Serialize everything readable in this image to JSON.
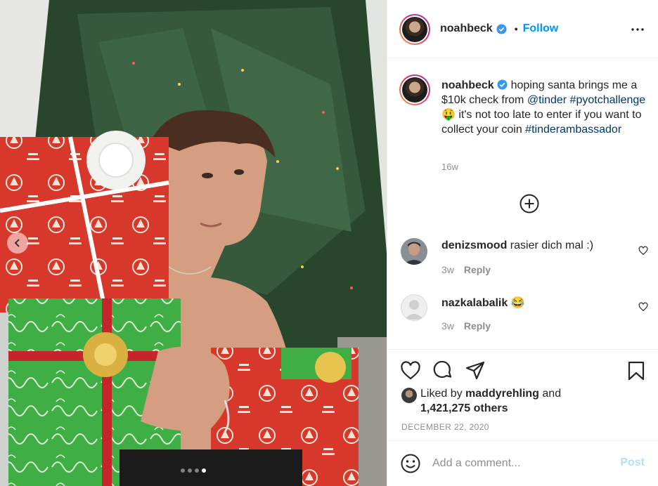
{
  "post": {
    "carousel": {
      "total_slides": 4,
      "active_slide": 4,
      "prev_icon": "chevron-left-icon"
    },
    "header": {
      "username": "noahbeck",
      "separator": "•",
      "follow_label": "Follow",
      "more_icon": "more-horizontal-icon",
      "verified_icon": "verified-badge-icon"
    },
    "caption": {
      "username": "noahbeck",
      "text_1": "hoping santa brings me a $10k check from ",
      "mention": "@tinder",
      "hashtag_1": "#pyotchallenge",
      "emoji": "🤑",
      "text_2": " it's not too late to enter if you want to collect your coin ",
      "hashtag_2": "#tinderambassador",
      "time_ago": "16w",
      "load_more_icon": "plus-circle-icon"
    },
    "comments": [
      {
        "username": "denizsmood",
        "text": "rasier dich mal :)",
        "time_ago": "3w",
        "reply_label": "Reply"
      },
      {
        "username": "nazkalabalik",
        "text": "😂",
        "time_ago": "3w",
        "reply_label": "Reply"
      }
    ],
    "actions": {
      "icons": [
        "heart-icon",
        "comment-icon",
        "share-icon",
        "bookmark-icon"
      ]
    },
    "likes": {
      "prefix": "Liked by ",
      "first_user": "maddyrehling",
      "joiner": " and",
      "others": "1,421,275 others"
    },
    "date": "DECEMBER 22, 2020",
    "add_comment": {
      "placeholder": "Add a comment...",
      "post_label": "Post",
      "emoji_icon": "smiley-icon"
    },
    "colors": {
      "accent": "#0095f6",
      "link": "#00376b",
      "muted": "#8e8e8e",
      "post_disabled": "#b2dffc",
      "text": "#262626"
    }
  }
}
